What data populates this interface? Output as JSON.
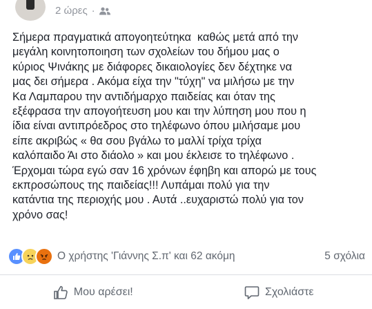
{
  "post": {
    "timestamp": "2 ώρες",
    "separator": "·",
    "audience_icon": "friends-icon",
    "text": "Σήμερα πραγματικά απογοητεύτηκα  καθώς μετά από την\nμεγάλη κοινητοποιηση των σχολείων του δήμου μας ο\nκύριος Ψινάκης με διάφορες δικαιολογίες δεν δέχτηκε να\nμας δει σήμερα . Ακόμα είχα την \"τύχη\" να μιλήσω με την\nΚα Λαμπαρου την αντιδήμαρχο παιδείας και όταν της\nεξέφρασα την απογοήτευση μου και την λύπηση μου που η\nίδια είναι αντιπρόεδρος στο τηλέφωνο όπου μιλήσαμε μου\nείπε ακριβώς « θα σου βγάλω το μαλλί τρίχα τρίχα\nκαλόπαιδο Άι στο διάολο » και μου έκλεισε το τηλέφωνο .\nΈρχομαι τώρα εγώ σαν 16 χρόνων έφηβη και απορώ με τους\nεκπροσώπους της παιδείας!!! Λυπάμαι πολύ για την\nκατάντια της περιοχής μου . Αυτά ..ευχαριστώ πολύ για τον\nχρόνο σας!"
  },
  "reactions": {
    "icons": [
      "like-reaction-icon",
      "sad-reaction-icon",
      "angry-reaction-icon"
    ],
    "summary": "Ο χρήστης 'Γιάννης Σ.π' και 62 ακόμη",
    "comments": "5 σχόλια"
  },
  "actions": {
    "like_label": "Μου αρέσει!",
    "comment_label": "Σχολιάστε"
  },
  "colors": {
    "like_blue": "#5890ff",
    "sad_yellow": "#f7d35a",
    "angry_orange": "#e9710f",
    "meta_gray": "#90949c",
    "action_gray": "#606770"
  }
}
